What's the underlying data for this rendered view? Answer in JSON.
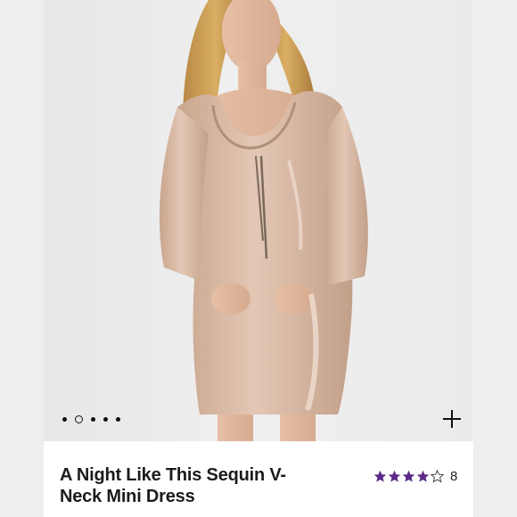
{
  "product": {
    "title": "A Night Like This Sequin V-Neck Mini Dress",
    "rating": 4,
    "rating_max": 5,
    "review_count": "8",
    "image_desc_icon": "product-photo"
  },
  "carousel": {
    "dot_count": 5,
    "active_index": 1
  },
  "actions": {
    "add_icon": "plus-icon"
  },
  "colors": {
    "star_fill": "#5b2a86",
    "dress": "#d8b7a0",
    "background": "#eeeeee"
  }
}
